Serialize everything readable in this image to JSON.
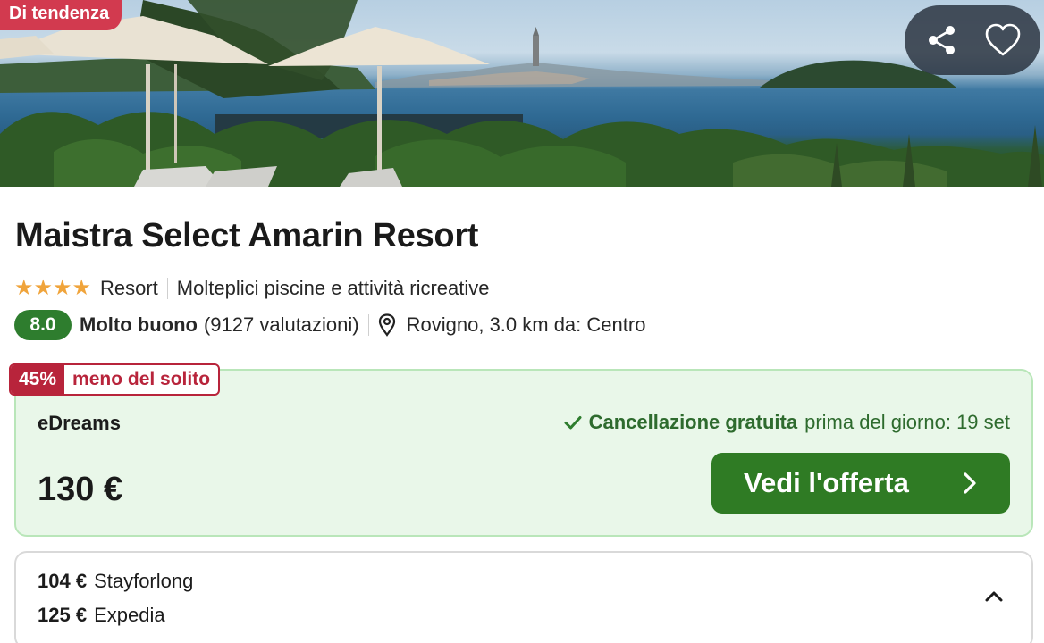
{
  "hero": {
    "badge": "Di tendenza",
    "share_icon": "share-icon",
    "favorite_icon": "heart-icon"
  },
  "hotel": {
    "name": "Maistra Select Amarin Resort",
    "star_count": 4,
    "stars": "★★★★",
    "type": "Resort",
    "feature": "Molteplici piscine e attività ricreative",
    "score": "8.0",
    "rating_word": "Molto buono",
    "reviews": "(9127 valutazioni)",
    "location": "Rovigno, 3.0 km da: Centro"
  },
  "offer": {
    "discount_pct": "45%",
    "discount_text": "meno del solito",
    "provider": "eDreams",
    "cancel_strong": "Cancellazione gratuita",
    "cancel_rest": "prima del giorno: 19 set",
    "price": "130 €",
    "cta_label": "Vedi l'offerta"
  },
  "other_offers": [
    {
      "amount": "104 €",
      "provider": "Stayforlong"
    },
    {
      "amount": "125 €",
      "provider": "Expedia"
    }
  ],
  "colors": {
    "trend": "#d23a4f",
    "score": "#2e7d2e",
    "discount": "#b8243b",
    "offer_bg": "#e9f7e9",
    "cta": "#2f7b24",
    "star": "#f0a43b"
  }
}
